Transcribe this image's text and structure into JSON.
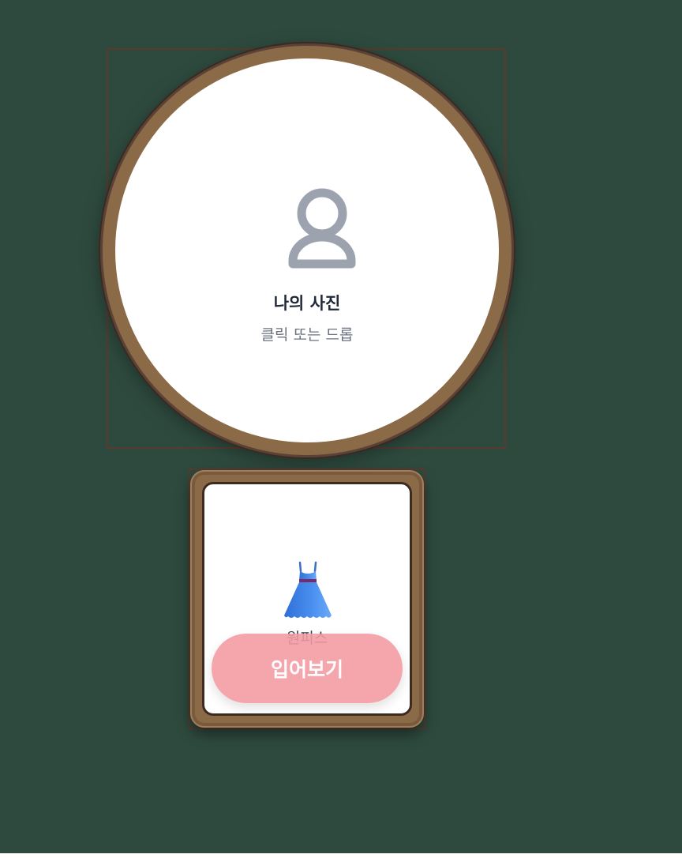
{
  "photo_upload": {
    "title": "나의 사진",
    "hint": "클릭 또는 드롭",
    "icon": "person-icon"
  },
  "clothing_card": {
    "icon": "dress-icon",
    "label": "원피스",
    "button_label": "입어보기"
  },
  "colors": {
    "background": "#2e4a3e",
    "frame_wood": "#8b6a47",
    "frame_border": "#5b4236",
    "button_pink": "#f49aa2",
    "icon_gray": "#9ca3af",
    "title_text": "#1f2937",
    "hint_text": "#6b7280"
  }
}
